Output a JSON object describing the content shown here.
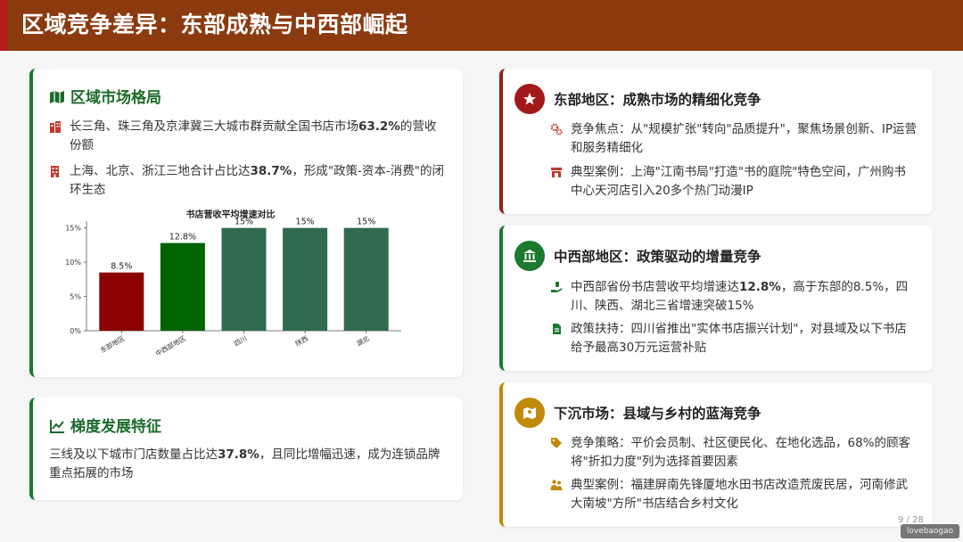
{
  "header": {
    "title": "区域竞争差异：东部成熟与中西部崛起"
  },
  "left_top": {
    "title": "区域市场格局",
    "bullets": [
      {
        "icon": "building-icon",
        "pre": "长三角、珠三角及京津冀三大城市群贡献全国书店市场",
        "bold": "63.2%",
        "post": "的营收份额"
      },
      {
        "icon": "office-building-icon",
        "pre": "上海、北京、浙江三地合计占比达",
        "bold": "38.7%",
        "post": "，形成\"政策-资本-消费\"的闭环生态"
      }
    ]
  },
  "chart_data": {
    "type": "bar",
    "title": "书店营收平均增速对比",
    "categories": [
      "东部地区",
      "中西部地区",
      "四川",
      "陕西",
      "湖北"
    ],
    "values": [
      8.5,
      12.8,
      15,
      15,
      15
    ],
    "data_labels": [
      "8.5%",
      "12.8%",
      "15%",
      "15%",
      "15%"
    ],
    "colors": [
      "#8b0000",
      "#006400",
      "#2e6b4f",
      "#2e6b4f",
      "#2e6b4f"
    ],
    "yticks": [
      "0%",
      "5%",
      "10%",
      "15%"
    ],
    "ylim": [
      0,
      16
    ],
    "xlabel": "",
    "ylabel": "",
    "grid": false
  },
  "left_bottom": {
    "title": "梯度发展特征",
    "pre": "三线及以下城市门店数量占比达",
    "bold": "37.8%",
    "post": "，且同比增幅迅速，成为连锁品牌重点拓展的市场"
  },
  "east": {
    "title": "东部地区：成熟市场的精细化竞争",
    "badge_color": "#a11a1a",
    "bullets": [
      {
        "icon": "gears-icon",
        "text": "竞争焦点：从\"规模扩张\"转向\"品质提升\"，聚焦场景创新、IP运营和服务精细化"
      },
      {
        "icon": "store-icon",
        "text": "典型案例：上海\"江南书局\"打造\"书的庭院\"特色空间，广州购书中心天河店引入20多个热门动漫IP"
      }
    ]
  },
  "midwest": {
    "title": "中西部地区：政策驱动的增量竞争",
    "badge_color": "#1b7a2f",
    "bullets": [
      {
        "icon": "hand-money-icon",
        "pre": "中西部省份书店营收平均增速达",
        "bold": "12.8%",
        "post": "，高于东部的8.5%，四川、陕西、湖北三省增速突破15%"
      },
      {
        "icon": "document-icon",
        "text": "政策扶持：四川省推出\"实体书店振兴计划\"，对县域及以下书店给予最高30万元运营补贴"
      }
    ]
  },
  "rural": {
    "title": "下沉市场：县域与乡村的蓝海竞争",
    "badge_color": "#c28a0c",
    "bullets": [
      {
        "icon": "tag-icon",
        "text": "竞争策略：平价会员制、社区便民化、在地化选品，68%的顾客将\"折扣力度\"列为选择首要因素"
      },
      {
        "icon": "people-icon",
        "text": "典型案例：福建屏南先锋厦地水田书店改造荒废民居，河南修武大南坡\"方所\"书店结合乡村文化"
      }
    ]
  },
  "footer": {
    "page": "9 / 28",
    "watermark": "lovebaogao"
  },
  "colors": {
    "header": "#8b3a10",
    "green": "#1b6b2a",
    "red": "#a11a1a",
    "gold": "#c28a0c"
  }
}
